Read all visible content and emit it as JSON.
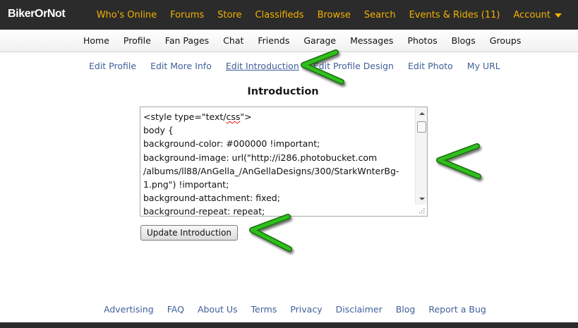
{
  "site": {
    "logo": "BikerOrNot"
  },
  "topnav": [
    {
      "label": "Who's Online"
    },
    {
      "label": "Forums"
    },
    {
      "label": "Store"
    },
    {
      "label": "Classifieds"
    },
    {
      "label": "Browse"
    },
    {
      "label": "Search"
    },
    {
      "label": "Events & Rides (11)"
    },
    {
      "label": "Account",
      "icon": "caret-down-icon"
    }
  ],
  "mainnav": [
    {
      "label": "Home"
    },
    {
      "label": "Profile"
    },
    {
      "label": "Fan Pages"
    },
    {
      "label": "Chat"
    },
    {
      "label": "Friends"
    },
    {
      "label": "Garage"
    },
    {
      "label": "Messages"
    },
    {
      "label": "Photos"
    },
    {
      "label": "Blogs"
    },
    {
      "label": "Groups"
    }
  ],
  "subnav": [
    {
      "label": "Edit Profile"
    },
    {
      "label": "Edit More Info"
    },
    {
      "label": "Edit Introduction",
      "active": true
    },
    {
      "label": "Edit Profile Design"
    },
    {
      "label": "Edit Photo"
    },
    {
      "label": "My URL"
    }
  ],
  "intro": {
    "title": "Introduction",
    "lines": [
      "<style type=\"text/css\">",
      "body {",
      "background-color: #000000 !important;",
      "background-image: url(\"http://i286.photobucket.com",
      "/albums/ll88/AnGella_/AnGellaDesigns/300/StarkWnterBg-",
      "1.png\") !important;",
      "background-attachment: fixed;",
      "background-repeat: repeat;"
    ],
    "button_label": "Update Introduction"
  },
  "footer": [
    {
      "label": "Advertising"
    },
    {
      "label": "FAQ"
    },
    {
      "label": "About Us"
    },
    {
      "label": "Terms"
    },
    {
      "label": "Privacy"
    },
    {
      "label": "Disclaimer"
    },
    {
      "label": "Blog"
    },
    {
      "label": "Report a Bug"
    }
  ],
  "colors": {
    "topbar": "#2b2b2b",
    "topnav_link": "#f2b200",
    "link": "#40609a",
    "annotation_arrow": "#2fbf1f"
  }
}
